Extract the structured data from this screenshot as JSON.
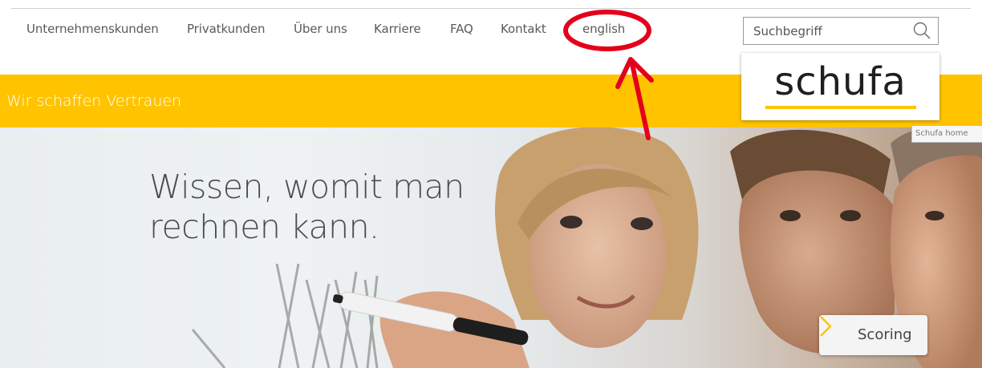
{
  "nav": {
    "items": [
      "Unternehmenskunden",
      "Privatkunden",
      "Über uns",
      "Karriere",
      "FAQ",
      "Kontakt",
      "english"
    ]
  },
  "search": {
    "placeholder": "Suchbegriff",
    "icon": "search-icon"
  },
  "banner": {
    "tagline": "Wir schaffen Vertrauen",
    "color": "#ffc300"
  },
  "logo": {
    "text": "schufa",
    "accent": "#ffc300"
  },
  "tooltip": {
    "text": "Schufa home"
  },
  "hero": {
    "headline_line1": "Wissen, womit man",
    "headline_line2": "rechnen kann."
  },
  "cta": {
    "label": "Scoring",
    "icon": "chevron-right-icon",
    "icon_color": "#ffc300"
  },
  "annotation": {
    "color": "#e3001b"
  }
}
